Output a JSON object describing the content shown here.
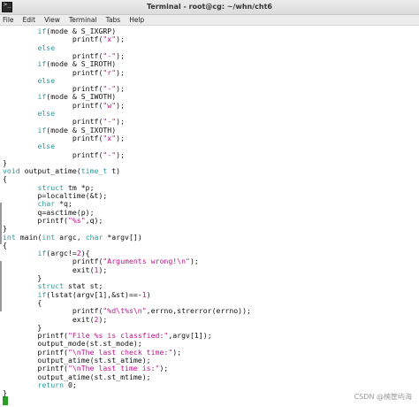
{
  "window": {
    "title": "Terminal - root@cg: ~/whn/cht6"
  },
  "menu": [
    "File",
    "Edit",
    "View",
    "Terminal",
    "Tabs",
    "Help"
  ],
  "icons": {
    "app": "terminal-icon"
  },
  "colors": {
    "keyword": "#2a9a9a",
    "string": "#c0148a",
    "cursor": "#28a028"
  },
  "code": [
    "        if(mode & S_IXGRP)",
    "                printf(\"x\");",
    "        else",
    "                printf(\"-\");",
    "        if(mode & S_IROTH)",
    "                printf(\"r\");",
    "        else",
    "                printf(\"-\");",
    "        if(mode & S_IWOTH)",
    "                printf(\"w\");",
    "        else",
    "                printf(\"-\");",
    "        if(mode & S_IXOTH)",
    "                printf(\"x\");",
    "        else",
    "                printf(\"-\");",
    "}",
    "void output_atime(time_t t)",
    "{",
    "        struct tm *p;",
    "        p=localtime(&t);",
    "        char *q;",
    "        q=asctime(p);",
    "        printf(\"%s\",q);",
    "}",
    "int main(int argc, char *argv[])",
    "{",
    "        if(argc!=2){",
    "                printf(\"Arguments wrong!\\n\");",
    "                exit(1);",
    "        }",
    "        struct stat st;",
    "        if(lstat(argv[1],&st)==-1)",
    "        {",
    "                printf(\"%d\\t%s\\n\",errno,strerror(errno));",
    "                exit(2);",
    "        }",
    "        printf(\"File %s is classfied:\",argv[1]);",
    "        output_mode(st.st_mode);",
    "        printf(\"\\nThe last check time:\");",
    "        output_atime(st.st_atime);",
    "        printf(\"\\nThe last time is:\");",
    "        output_atime(st.st_mtime);",
    "        return 0;",
    "}"
  ],
  "watermark": "CSDN @楠筐屿海"
}
